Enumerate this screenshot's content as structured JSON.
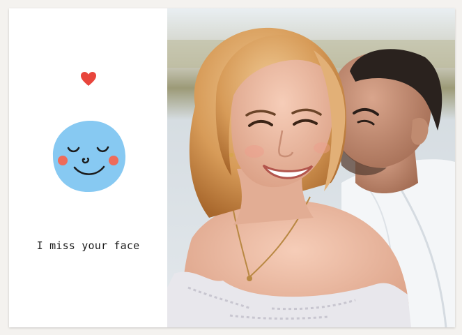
{
  "card": {
    "message": "I miss your face",
    "icons": {
      "heart": "heart-icon",
      "face": "smiling-face-icon"
    },
    "colors": {
      "heart": "#e8453c",
      "face": "#87c9f2",
      "cheeks": "#ef6b5a",
      "ink": "#1b1b1b",
      "background": "#f4f2ef"
    }
  }
}
